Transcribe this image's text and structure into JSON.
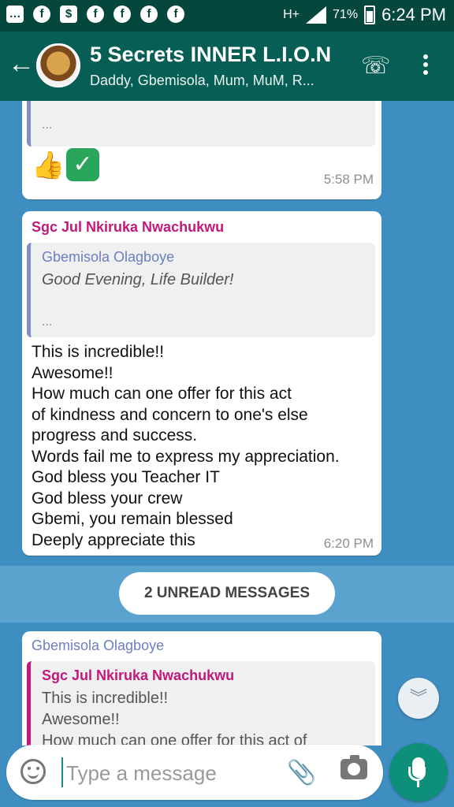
{
  "status_bar": {
    "clock": "6:24 PM",
    "battery": "71%",
    "network": "H+"
  },
  "header": {
    "group_name": "5 Secrets INNER L.I.O.N",
    "members": "Daddy, Gbemisola, Mum, MuM, R..."
  },
  "messages": [
    {
      "quote_dots": "...",
      "time": "5:58 PM"
    },
    {
      "sender": "Sgc Jul Nkiruka Nwachukwu",
      "sender_color": "#c2187a",
      "quote_name": "Gbemisola Olagboye",
      "quote_text": "Good Evening, Life Builder!",
      "quote_dots": "...",
      "body": "This is incredible!!\nAwesome!!\nHow much can one offer for this act\nof kindness and concern to one's else\nprogress and success.\nWords fail me to express my appreciation.\nGod bless you Teacher IT\nGod bless your crew\nGbemi, you remain blessed\nDeeply appreciate this",
      "time": "6:20 PM"
    },
    {
      "sender": "Gbemisola Olagboye",
      "sender_color": "#6c7fc2",
      "quote_name": "Sgc Jul Nkiruka Nwachukwu",
      "quote_text": "This is incredible!!\nAwesome!!\nHow much can one offer for this act of"
    }
  ],
  "unread_label": "2 UNREAD MESSAGES",
  "composer": {
    "placeholder": "Type a message"
  },
  "colors": {
    "header": "#075e54",
    "chat_background": "#3f8ec2",
    "accent": "#0d8f7a"
  }
}
